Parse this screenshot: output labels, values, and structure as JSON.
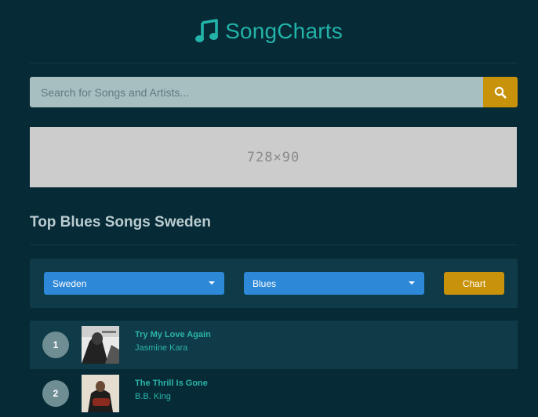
{
  "brand": {
    "name": "SongCharts",
    "accent": "#23b3a8"
  },
  "search": {
    "placeholder": "Search for Songs and Artists...",
    "value": ""
  },
  "ad": {
    "label": "728×90"
  },
  "page": {
    "title": "Top Blues Songs Sweden"
  },
  "filters": {
    "country": "Sweden",
    "genre": "Blues",
    "button_label": "Chart"
  },
  "songs": [
    {
      "rank": "1",
      "title": "Try My Love Again",
      "artist": "Jasmine Kara"
    },
    {
      "rank": "2",
      "title": "The Thrill Is Gone",
      "artist": "B.B. King"
    }
  ],
  "colors": {
    "background": "#062a36",
    "panel": "#0f3a47",
    "select": "#2e88d8",
    "button": "#c8920a"
  }
}
